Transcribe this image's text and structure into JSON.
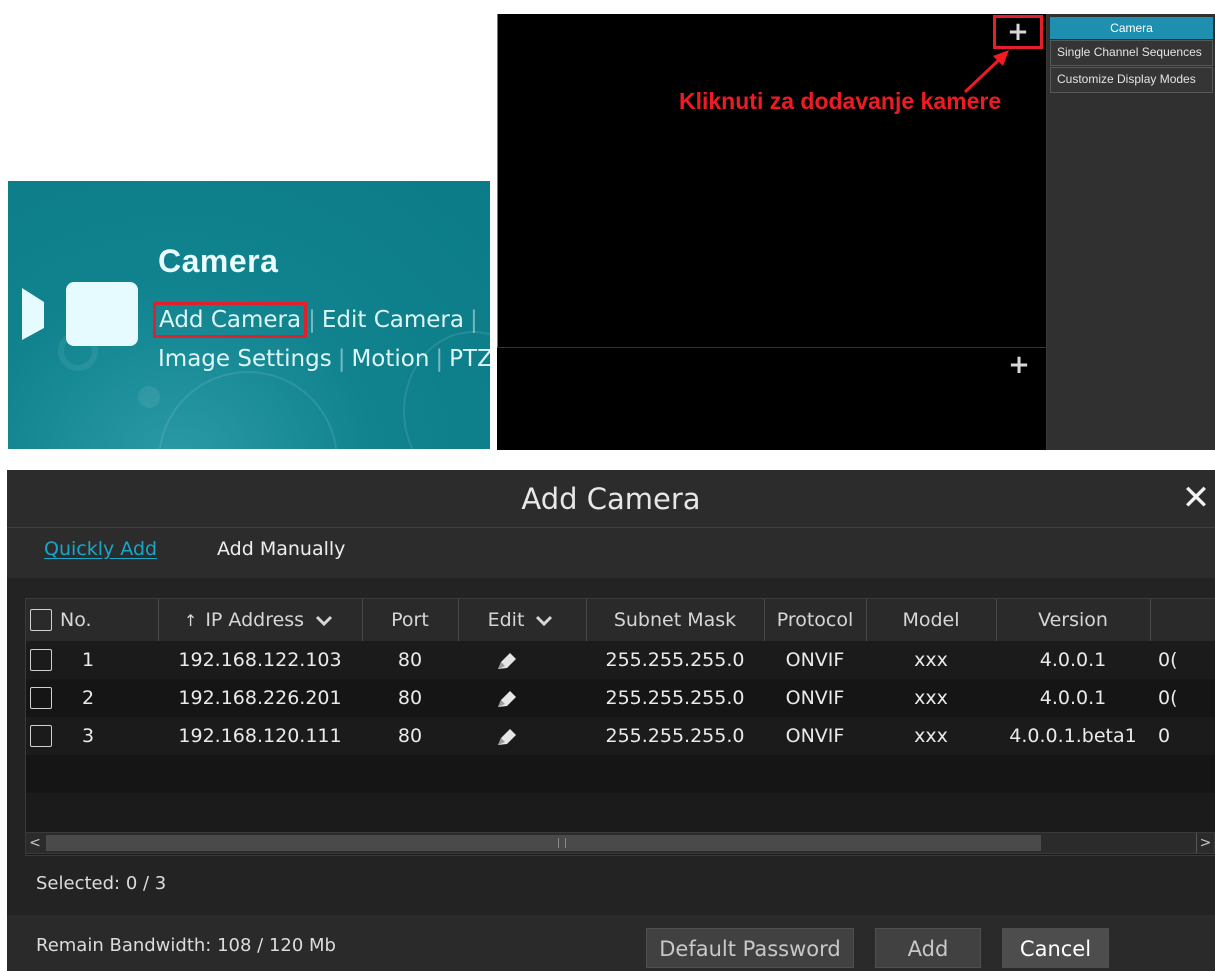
{
  "camera_panel": {
    "title": "Camera",
    "links_row1": [
      "Add Camera",
      "Edit Camera"
    ],
    "links_row2": [
      "Image Settings",
      "Motion",
      "PTZ"
    ],
    "icon": "video-camera-icon",
    "accent": "#0b7b87",
    "highlight": "#e0202a"
  },
  "live_view": {
    "annotation": "Kliknuti za dodavanje kamere",
    "plus_symbol": "+",
    "side_menu": [
      "Camera",
      "Single Channel Sequences",
      "Customize Display Modes"
    ]
  },
  "dialog": {
    "title": "Add Camera",
    "close_symbol": "✕",
    "tabs": {
      "quick": "Quickly Add",
      "manual": "Add Manually"
    },
    "columns": {
      "no": "No.",
      "ip": "IP Address",
      "port": "Port",
      "edit": "Edit",
      "subnet": "Subnet Mask",
      "protocol": "Protocol",
      "model": "Model",
      "version": "Version"
    },
    "rows": [
      {
        "no": "1",
        "ip": "192.168.122.103",
        "port": "80",
        "subnet": "255.255.255.0",
        "protocol": "ONVIF",
        "model": "xxx",
        "version": "4.0.0.1",
        "extra": "0("
      },
      {
        "no": "2",
        "ip": "192.168.226.201",
        "port": "80",
        "subnet": "255.255.255.0",
        "protocol": "ONVIF",
        "model": "xxx",
        "version": "4.0.0.1",
        "extra": "0("
      },
      {
        "no": "3",
        "ip": "192.168.120.111",
        "port": "80",
        "subnet": "255.255.255.0",
        "protocol": "ONVIF",
        "model": "xxx",
        "version": "4.0.0.1.beta1",
        "extra": "0"
      }
    ],
    "selected": "Selected: 0 / 3",
    "bandwidth": "Remain Bandwidth: 108 / 120 Mb",
    "buttons": {
      "default_password": "Default Password",
      "add": "Add",
      "cancel": "Cancel"
    },
    "accent": "#18a6c9"
  }
}
